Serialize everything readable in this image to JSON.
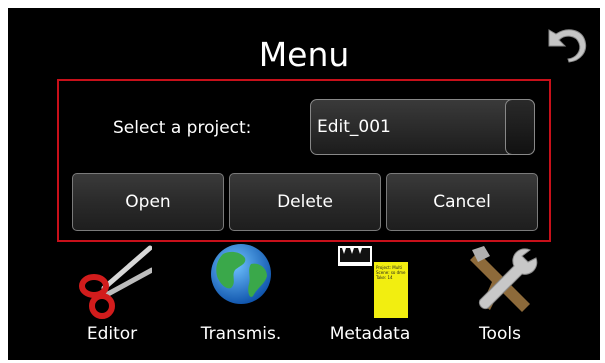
{
  "header": {
    "title": "Menu",
    "back_icon": "undo-icon"
  },
  "dialog": {
    "prompt": "Select a project:",
    "project_select": {
      "value": "Edit_001"
    },
    "buttons": {
      "open": "Open",
      "delete": "Delete",
      "cancel": "Cancel"
    },
    "border_color": "#c8101a"
  },
  "apps": [
    {
      "label": "Editor",
      "icon": "scissors-icon"
    },
    {
      "label": "Transmis.",
      "icon": "globe-icon"
    },
    {
      "label": "Metadata",
      "icon": "clapperboard-note-icon",
      "note_text": [
        "Project: Multi",
        "Scene: so dme",
        "Take: 14"
      ]
    },
    {
      "label": "Tools",
      "icon": "wrench-hammer-icon"
    }
  ]
}
